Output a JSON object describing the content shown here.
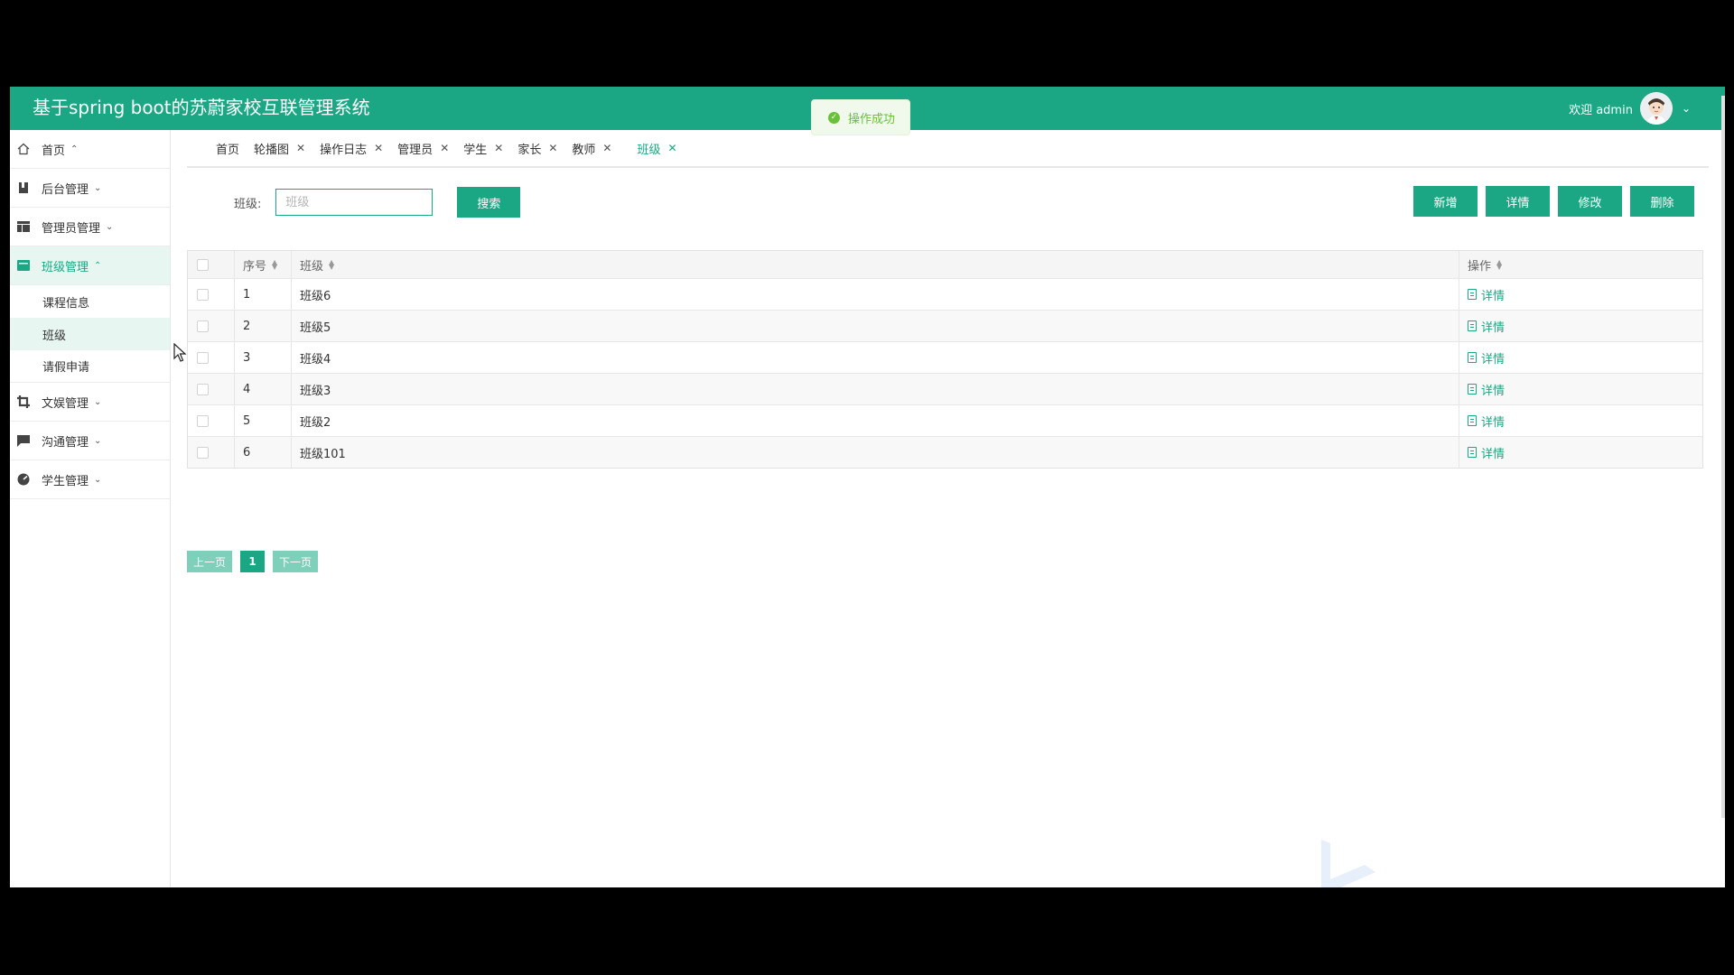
{
  "header": {
    "title": "基于spring boot的苏蔚家校互联管理系统",
    "welcome": "欢迎 admin",
    "avatar_icon": "user-avatar",
    "user_menu_icon": "chevron-down-icon",
    "brand_color": "#1ba784"
  },
  "toast": {
    "message": "操作成功",
    "icon": "check-circle-icon",
    "color": "#67c23a"
  },
  "sidebar": {
    "items": [
      {
        "label": "首页",
        "icon": "home-icon",
        "chevron": "^"
      },
      {
        "label": "后台管理",
        "icon": "book-icon",
        "chevron": "v"
      },
      {
        "label": "管理员管理",
        "icon": "layout-icon",
        "chevron": "v"
      },
      {
        "label": "班级管理",
        "icon": "card-icon",
        "chevron": "^",
        "active": true
      },
      {
        "label": "文娱管理",
        "icon": "crop-icon",
        "chevron": "v"
      },
      {
        "label": "沟通管理",
        "icon": "chat-icon",
        "chevron": "v"
      },
      {
        "label": "学生管理",
        "icon": "gauge-icon",
        "chevron": "v"
      }
    ],
    "submenu": [
      {
        "label": "课程信息"
      },
      {
        "label": "班级",
        "selected": true
      },
      {
        "label": "请假申请"
      }
    ]
  },
  "tabs": [
    {
      "label": "首页",
      "closable": false
    },
    {
      "label": "轮播图",
      "closable": true
    },
    {
      "label": "操作日志",
      "closable": true
    },
    {
      "label": "管理员",
      "closable": true
    },
    {
      "label": "学生",
      "closable": true
    },
    {
      "label": "家长",
      "closable": true
    },
    {
      "label": "教师",
      "closable": true
    },
    {
      "label": "班级",
      "closable": true,
      "active": true
    }
  ],
  "search": {
    "label": "班级:",
    "placeholder": "班级",
    "value": "",
    "button": "搜索"
  },
  "actions": {
    "add": "新增",
    "detail": "详情",
    "edit": "修改",
    "delete": "删除"
  },
  "table": {
    "columns": {
      "index": "序号",
      "name": "班级",
      "op": "操作"
    },
    "op_label": "详情",
    "rows": [
      {
        "index": "1",
        "name": "班级6"
      },
      {
        "index": "2",
        "name": "班级5"
      },
      {
        "index": "3",
        "name": "班级4"
      },
      {
        "index": "4",
        "name": "班级3"
      },
      {
        "index": "5",
        "name": "班级2"
      },
      {
        "index": "6",
        "name": "班级101"
      }
    ]
  },
  "pager": {
    "prev": "上一页",
    "current": "1",
    "next": "下一页"
  }
}
